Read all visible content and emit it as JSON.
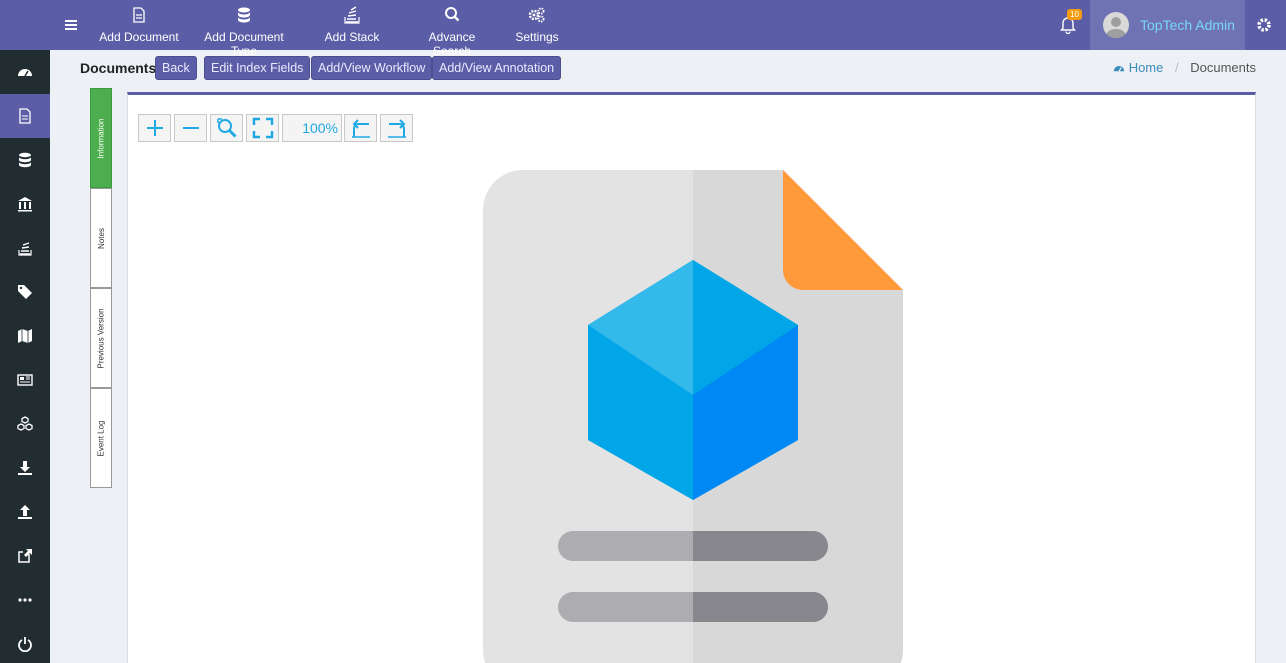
{
  "topbar": {
    "actions": [
      {
        "label": "Add Document",
        "icon": "file-icon"
      },
      {
        "label": "Add Document Type",
        "icon": "database-icon"
      },
      {
        "label": "Add Stack",
        "icon": "stack-icon"
      },
      {
        "label": "Advance Search",
        "icon": "search-icon"
      },
      {
        "label": "Settings",
        "icon": "cogs-icon"
      }
    ],
    "notifications": "10",
    "user_name": "TopTech Admin"
  },
  "sidebar": {
    "items": [
      {
        "icon": "dashboard-icon"
      },
      {
        "icon": "document-icon",
        "active": true
      },
      {
        "icon": "database-icon"
      },
      {
        "icon": "bank-icon"
      },
      {
        "icon": "stack-icon"
      },
      {
        "icon": "tags-icon"
      },
      {
        "icon": "map-icon"
      },
      {
        "icon": "newspaper-icon"
      },
      {
        "icon": "cubes-icon"
      },
      {
        "icon": "download-icon"
      },
      {
        "icon": "upload-icon"
      },
      {
        "icon": "share-icon"
      },
      {
        "icon": "more-icon"
      },
      {
        "icon": "power-icon"
      }
    ]
  },
  "header": {
    "title": "Documents",
    "buttons": [
      "Back",
      "Edit Index Fields",
      "Add/View Workflow",
      "Add/View Annotation"
    ],
    "breadcrumb": {
      "home": "Home",
      "current": "Documents"
    }
  },
  "tabs": [
    "Information",
    "Notes",
    "Previous Version",
    "Event Log"
  ],
  "viewer": {
    "zoom": "100%"
  },
  "colors": {
    "brand": "#5b5ea6",
    "sidebar": "#222d32",
    "active_tab": "#4cae4c",
    "tool_icon": "#1fa9e4"
  }
}
